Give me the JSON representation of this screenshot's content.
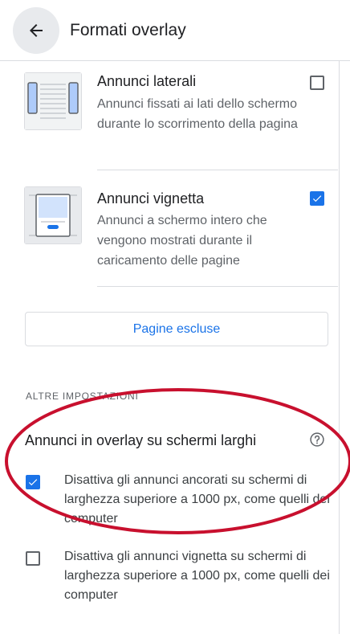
{
  "header": {
    "title": "Formati overlay",
    "back_icon": "arrow-back-icon"
  },
  "formats": [
    {
      "title": "Annunci laterali",
      "description": "Annunci fissati ai lati dello schermo durante lo scorrimento della pagina",
      "checked": false,
      "icon": "side-rails-thumbnail"
    },
    {
      "title": "Annunci vignetta",
      "description": "Annunci a schermo intero che vengono mostrati durante il caricamento delle pagine",
      "checked": true,
      "icon": "vignette-thumbnail"
    }
  ],
  "excluded_pages_button": "Pagine escluse",
  "other_settings": {
    "label": "ALTRE IMPOSTAZIONI",
    "title": "Annunci in overlay su schermi larghi",
    "help_icon": "help-circle-icon",
    "options": [
      {
        "text": "Disattiva gli annunci ancorati su schermi di larghezza superiore a 1000 px, come quelli dei computer",
        "checked": true
      },
      {
        "text": "Disattiva gli annunci vignetta su schermi di larghezza superiore a 1000 px, come quelli dei computer",
        "checked": false
      }
    ]
  },
  "colors": {
    "accent": "#1a73e8",
    "annotation": "#c8102e",
    "divider": "#dadce0"
  }
}
